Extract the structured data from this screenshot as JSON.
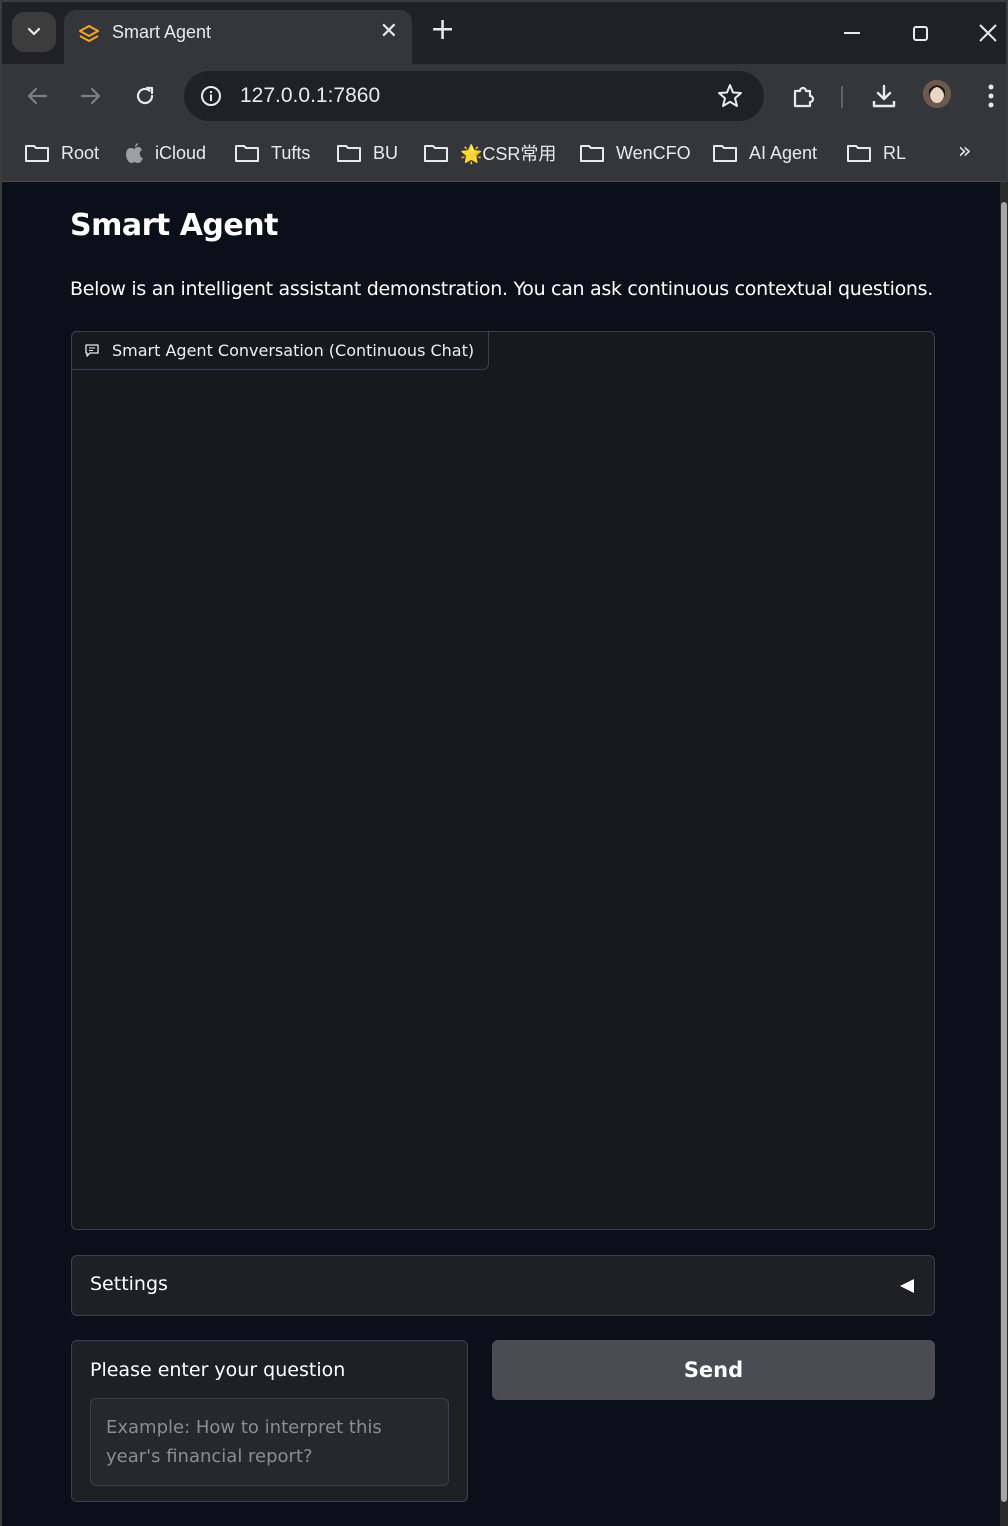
{
  "browser": {
    "tab_title": "Smart Agent",
    "tab_close": "✕",
    "new_tab": "+",
    "url": "127.0.0.1:7860",
    "bookmarks": [
      {
        "label": "Root",
        "icon": "folder-icon"
      },
      {
        "label": "iCloud",
        "icon": "apple-icon"
      },
      {
        "label": "Tufts",
        "icon": "folder-icon"
      },
      {
        "label": "BU",
        "icon": "folder-icon"
      },
      {
        "label": "🌟CSR常用",
        "icon": "folder-icon"
      },
      {
        "label": "WenCFO",
        "icon": "folder-icon"
      },
      {
        "label": "AI Agent",
        "icon": "folder-icon"
      },
      {
        "label": "RL",
        "icon": "folder-icon"
      }
    ],
    "bookmarks_more": "»"
  },
  "page": {
    "title": "Smart Agent",
    "description": "Below is an intelligent assistant demonstration. You can ask continuous contextual questions.",
    "chatbot_label": "Smart Agent Conversation (Continuous Chat)",
    "settings_label": "Settings",
    "question_label": "Please enter your question",
    "question_placeholder": "Example: How to interpret this year's financial report?",
    "send_label": "Send"
  },
  "colors": {
    "page_bg": "#0b0f19",
    "panel_bg": "#18191c",
    "border": "#374151",
    "send_bg": "#4a4b53",
    "favicon": "#f5a623"
  }
}
